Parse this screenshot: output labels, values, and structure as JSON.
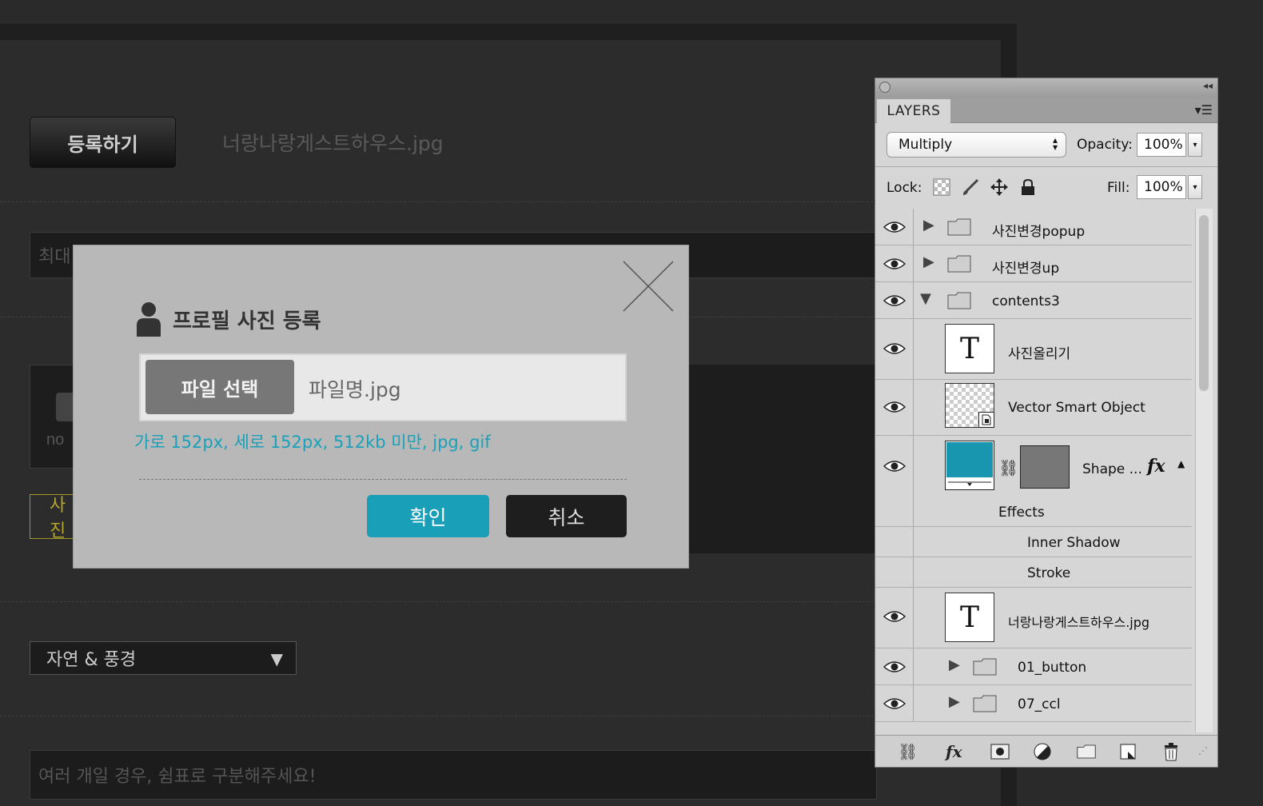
{
  "page": {
    "register_button": "등록하기",
    "uploaded_filename": "너랑나랑게스트하우스.jpg",
    "max_input_placeholder": "최대",
    "photo_placeholder": "no",
    "yellow_button": "사진",
    "category_select": "자연 & 풍경",
    "tags_placeholder": "여러 개일 경우, 쉼표로 구분해주세요!"
  },
  "modal": {
    "title": "프로필 사진 등록",
    "file_button": "파일 선택",
    "file_name": "파일명.jpg",
    "hint": "가로 152px, 세로 152px, 512kb 미만, jpg, gif",
    "ok": "확인",
    "cancel": "취소"
  },
  "layers_panel": {
    "tab": "LAYERS",
    "blend_mode": "Multiply",
    "opacity_label": "Opacity:",
    "opacity": "100%",
    "lock_label": "Lock:",
    "fill_label": "Fill:",
    "fill": "100%",
    "layers": [
      {
        "name": "사진변경popup",
        "type": "group",
        "expanded": false
      },
      {
        "name": "사진변경up",
        "type": "group",
        "expanded": false
      },
      {
        "name": "contents3",
        "type": "group",
        "expanded": true
      },
      {
        "name": "사진올리기",
        "type": "text"
      },
      {
        "name": "Vector Smart Object",
        "type": "smart-object"
      },
      {
        "name": "Shape ...",
        "type": "shape"
      },
      {
        "name": "Effects",
        "type": "effects-header"
      },
      {
        "name": "Inner Shadow",
        "type": "effect"
      },
      {
        "name": "Stroke",
        "type": "effect"
      },
      {
        "name": "너랑나랑게스트하우스.jpg",
        "type": "text"
      },
      {
        "name": "01_button",
        "type": "group",
        "expanded": false
      },
      {
        "name": "07_ccl",
        "type": "group",
        "expanded": false
      }
    ]
  },
  "colors": {
    "accent": "#1a9fb8",
    "shape_fill": "#1896b0"
  }
}
